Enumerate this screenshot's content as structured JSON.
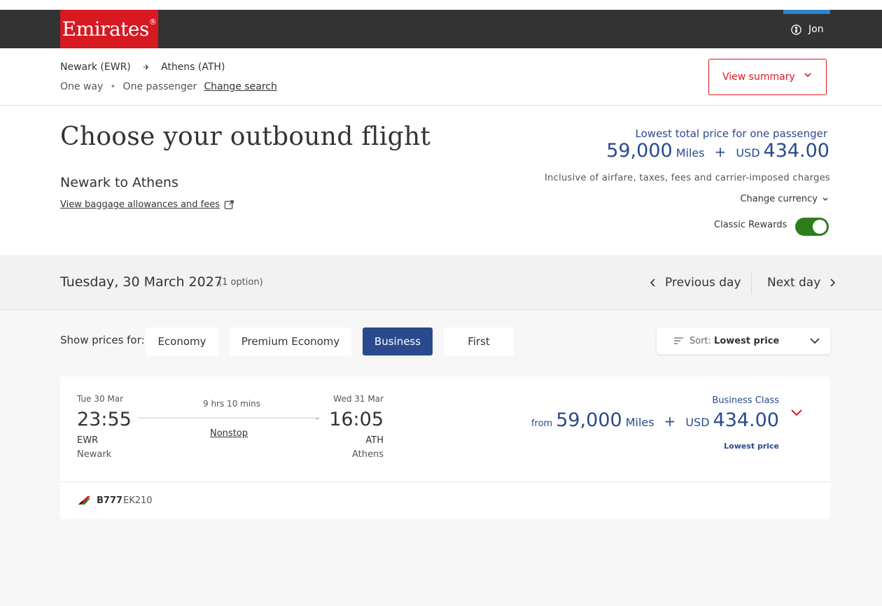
{
  "header": {
    "logo_text": "Emirates",
    "logo_mark": "®",
    "user_name": "Jon",
    "brand_color": "#d71921"
  },
  "search": {
    "origin": "Newark (EWR)",
    "destination": "Athens (ATH)",
    "trip_type": "One way",
    "passengers": "One passenger",
    "change_search": "Change search",
    "view_summary": "View summary"
  },
  "page": {
    "title": "Choose your outbound flight",
    "subtitle": "Newark to Athens",
    "baggage_link": "View baggage allowances and fees"
  },
  "price_summary": {
    "label": "Lowest total price for one passenger",
    "miles": "59,000",
    "miles_unit": "Miles",
    "plus": "+",
    "currency": "USD",
    "amount": "434.00",
    "inclusive": "Inclusive of airfare, taxes, fees and carrier-imposed charges",
    "change_currency": "Change currency",
    "classic_rewards": "Classic Rewards",
    "classic_rewards_on": true,
    "accent_color": "#2a4a8d"
  },
  "date_nav": {
    "date": "Tuesday, 30 March 2027",
    "options": "(1 option)",
    "previous": "Previous day",
    "next": "Next day"
  },
  "filters": {
    "show_prices_label": "Show prices for:",
    "cabins": [
      "Economy",
      "Premium Economy",
      "Business",
      "First"
    ],
    "selected_cabin": "Business",
    "sort_key": "Sort:",
    "sort_value": "Lowest price"
  },
  "flight": {
    "dep_date": "Tue 30 Mar",
    "dep_time": "23:55",
    "dep_code": "EWR",
    "dep_city": "Newark",
    "duration": "9 hrs 10 mins",
    "stops": "Nonstop",
    "arr_date": "Wed 31 Mar",
    "arr_time": "16:05",
    "arr_code": "ATH",
    "arr_city": "Athens",
    "class_label": "Business Class",
    "from": "from",
    "miles": "59,000",
    "miles_unit": "Miles",
    "plus": "+",
    "currency": "USD",
    "amount": "434.00",
    "badge": "Lowest price",
    "aircraft": "B777",
    "flight_number": "EK210"
  }
}
